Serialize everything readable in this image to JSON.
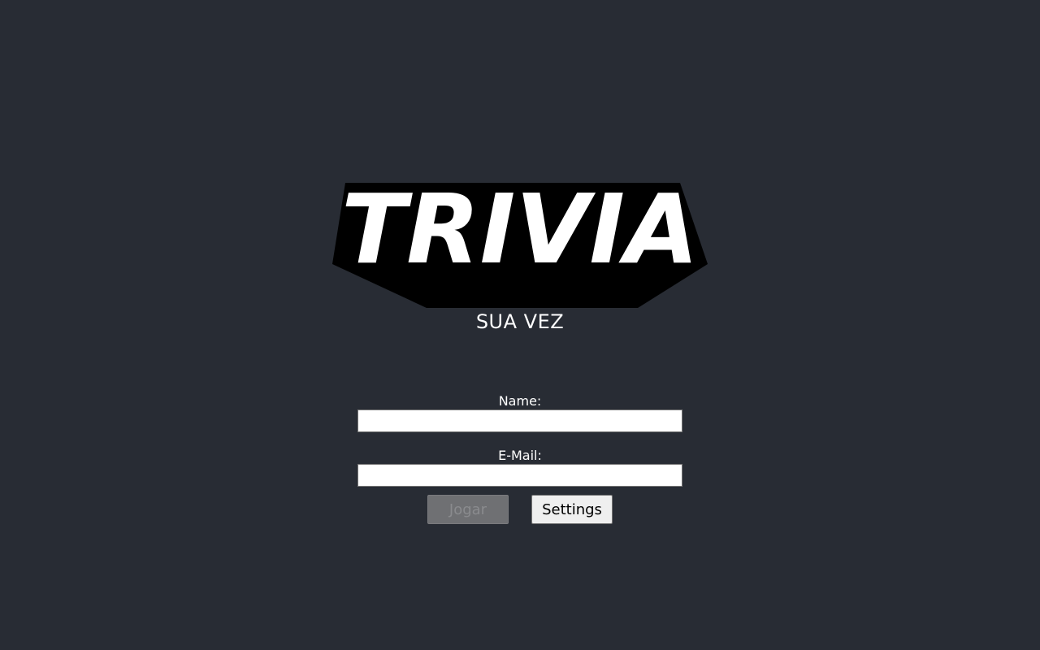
{
  "app": {
    "logo_text": "TRIVIA",
    "subtitle": "SUA VEZ"
  },
  "form": {
    "name_label": "Name:",
    "name_value": "",
    "email_label": "E-Mail:",
    "email_value": ""
  },
  "buttons": {
    "play_label": "Jogar",
    "play_disabled": true,
    "settings_label": "Settings"
  },
  "colors": {
    "background": "#282c34",
    "logo_fill": "#ffffff",
    "logo_shadow": "#000000",
    "text": "#ffffff"
  }
}
